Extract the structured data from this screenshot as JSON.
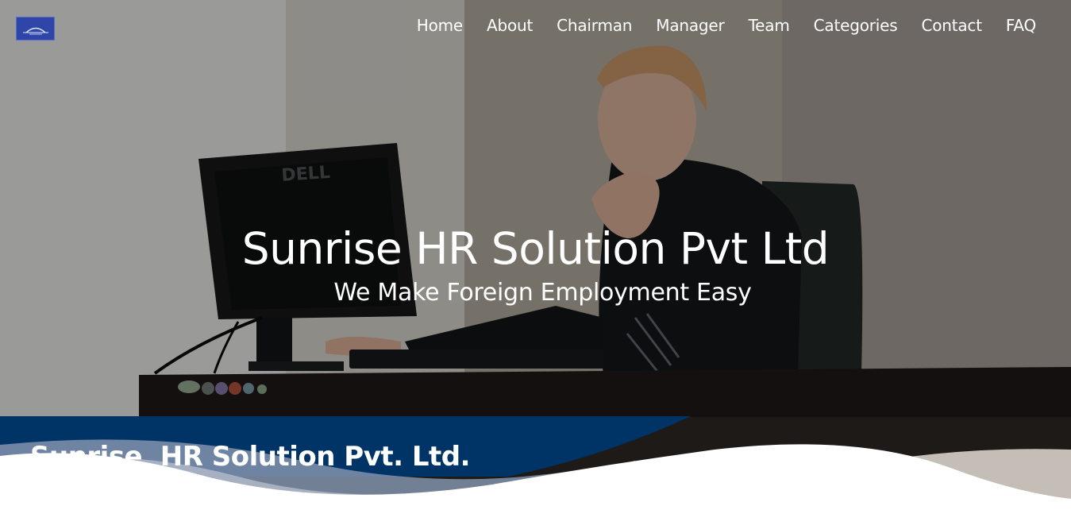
{
  "header": {
    "logo_alt": "Sunrise HR Solution logo",
    "nav": [
      {
        "label": "Home"
      },
      {
        "label": "About"
      },
      {
        "label": "Chairman"
      },
      {
        "label": "Manager"
      },
      {
        "label": "Team"
      },
      {
        "label": "Categories"
      },
      {
        "label": "Contact"
      },
      {
        "label": "FAQ"
      }
    ]
  },
  "hero": {
    "title": "Sunrise HR Solution Pvt Ltd",
    "subtitle": "We Make Foreign Employment Easy",
    "image_icon": "office-worker-photo"
  },
  "band": {
    "title": "Sunrise  HR Solution Pvt. Ltd."
  },
  "colors": {
    "navy": "#003366",
    "white": "#ffffff",
    "logo_blue": "#2f46a8"
  }
}
